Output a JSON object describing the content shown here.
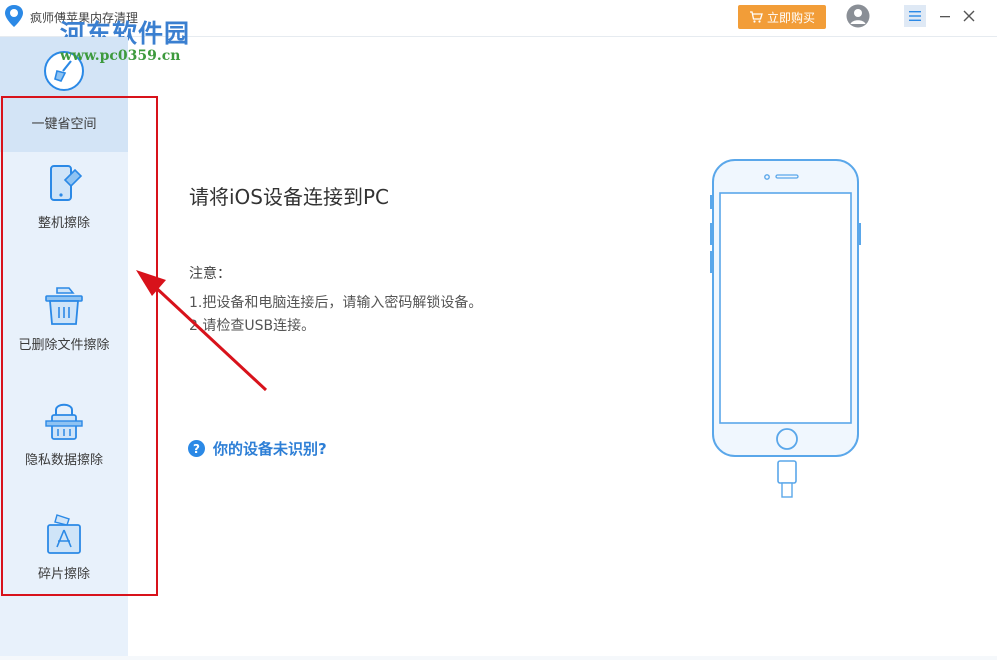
{
  "titlebar": {
    "app_title": "疯师傅苹果内存清理",
    "watermark_title": "河东软件园",
    "watermark_url": "www.pc0359.cn",
    "buy_label": "立即购买"
  },
  "sidebar": {
    "items": [
      {
        "label": "一键省空间",
        "icon": "broom-icon",
        "active": true
      },
      {
        "label": "整机擦除",
        "icon": "phone-eraser-icon",
        "active": false
      },
      {
        "label": "已删除文件擦除",
        "icon": "trash-icon",
        "active": false
      },
      {
        "label": "隐私数据擦除",
        "icon": "lock-icon",
        "active": false
      },
      {
        "label": "碎片擦除",
        "icon": "app-fragment-icon",
        "active": false
      }
    ]
  },
  "main": {
    "title": "请将iOS设备连接到PC",
    "note_label": "注意：",
    "notes": [
      "1.把设备和电脑连接后，请输入密码解锁设备。",
      "2.请检查USB连接。"
    ],
    "help_link": "你的设备未识别?"
  },
  "colors": {
    "accent": "#2b89e6",
    "buy_button": "#f29d38",
    "sidebar_bg": "#e8f1fb",
    "highlight": "#d8121b"
  }
}
